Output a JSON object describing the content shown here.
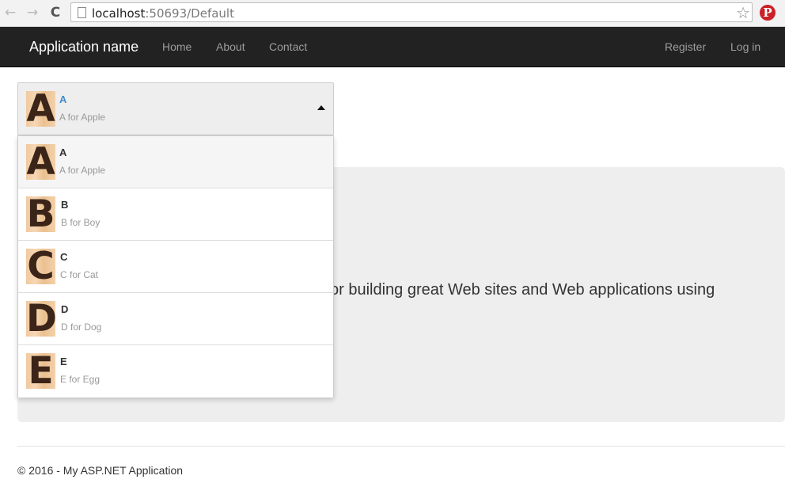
{
  "browser": {
    "back_glyph": "←",
    "forward_glyph": "→",
    "reload_glyph": "C",
    "url_host": "localhost",
    "url_rest": ":50693/Default",
    "star_glyph": "☆",
    "pinterest_glyph": "P"
  },
  "navbar": {
    "brand": "Application name",
    "links": [
      "Home",
      "About",
      "Contact"
    ],
    "right_links": [
      "Register",
      "Log in"
    ]
  },
  "select": {
    "selected": {
      "letter": "A",
      "title": "A",
      "subtitle": "A for Apple"
    },
    "options": [
      {
        "letter": "A",
        "title": "A",
        "subtitle": "A for Apple"
      },
      {
        "letter": "B",
        "title": "B",
        "subtitle": "B for Boy"
      },
      {
        "letter": "C",
        "title": "C",
        "subtitle": "C for Cat"
      },
      {
        "letter": "D",
        "title": "D",
        "subtitle": "D for Dog"
      },
      {
        "letter": "E",
        "title": "E",
        "subtitle": "E for Egg"
      }
    ]
  },
  "jumbotron": {
    "text": "or building great Web sites and Web applications using"
  },
  "footer": {
    "text": "© 2016 - My ASP.NET Application"
  },
  "colors": {
    "navbar_bg": "#222222",
    "selected_title": "#428bca",
    "jumbotron_bg": "#eeeeee"
  }
}
